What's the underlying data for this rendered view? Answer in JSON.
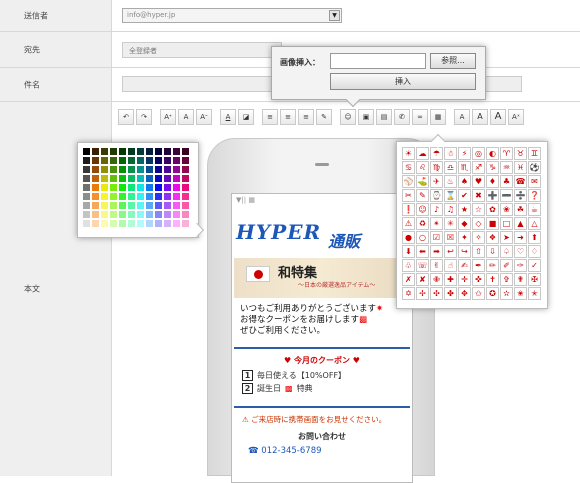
{
  "form": {
    "sender_label": "送信者",
    "sender_value": "info@hyper.jp",
    "to_label": "宛先",
    "to_value": "全登録者",
    "subject_label": "件名",
    "body_label": "本文"
  },
  "toolbar": {
    "buttons": [
      "undo-icon",
      "redo-icon",
      "A",
      "A",
      "A",
      "A",
      "A",
      "align-left",
      "align-center",
      "align-right",
      "brush",
      "emoji",
      "image",
      "link",
      "blink",
      "page",
      "A",
      "A",
      "A",
      "A"
    ]
  },
  "image_dialog": {
    "label": "画像挿入：",
    "browse": "参照...",
    "insert": "挿入"
  },
  "preview": {
    "status": "▼|| ▦",
    "logo_latin": "HYPER",
    "logo_jp": "通販",
    "banner_title": "和特集",
    "banner_sub": "～日本の厳選逸品アイテム～",
    "message_1": "いつもご利用ありがとうございます",
    "message_2": "お得なクーポンをお届けします",
    "message_3": "ぜひご利用ください。",
    "coupon_title": "♥ 今月のクーポン ♥",
    "coupon_1": "毎日使える【10%OFF】",
    "coupon_2": "誕生日",
    "coupon_2_suffix": "特典",
    "notice": "⚠ ご来店時に携帯画面をお見せください。",
    "contact_title": "お問い合わせ",
    "tel": "☎ 012-345-6789"
  },
  "colors": {
    "accent": "#1d57b8",
    "alert": "#cc0000"
  }
}
